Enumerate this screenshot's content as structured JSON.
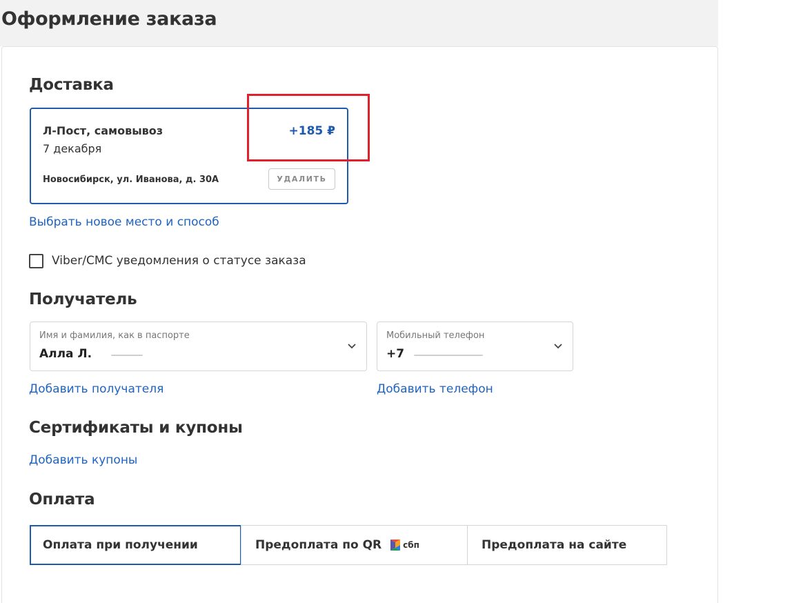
{
  "page": {
    "title": "Оформление заказа"
  },
  "delivery": {
    "section_title": "Доставка",
    "method": "Л-Пост, самовывоз",
    "date": "7 декабря",
    "price": "+185 ₽",
    "address": "Новосибирск, ул. Иванова, д. 30А",
    "delete_label": "УДАЛИТЬ",
    "change_link": "Выбрать новое место и способ"
  },
  "notifications": {
    "label": "Viber/СМС уведомления о статусе заказа",
    "checked": false
  },
  "recipient": {
    "section_title": "Получатель",
    "name_field": {
      "label": "Имя и фамилия, как в паспорте",
      "value": "Алла Л."
    },
    "phone_field": {
      "label": "Мобильный телефон",
      "value": "+7"
    },
    "add_recipient_link": "Добавить получателя",
    "add_phone_link": "Добавить телефон"
  },
  "coupons": {
    "section_title": "Сертификаты и купоны",
    "add_link": "Добавить купоны"
  },
  "payment": {
    "section_title": "Оплата",
    "options": [
      {
        "label": "Оплата при получении",
        "selected": true
      },
      {
        "label": "Предоплата по QR",
        "badge": "сбп",
        "selected": false
      },
      {
        "label": "Предоплата на сайте",
        "selected": false
      }
    ]
  },
  "colors": {
    "accent": "#1e5bb0",
    "link": "#1e63c3",
    "highlight": "#e0202a"
  }
}
